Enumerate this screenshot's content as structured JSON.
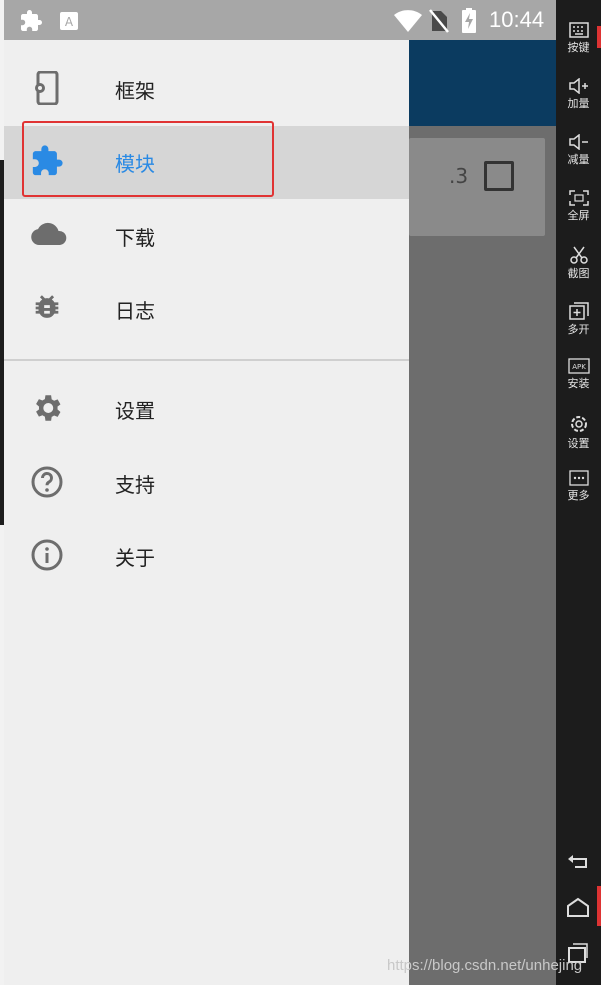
{
  "status_bar": {
    "time": "10:44",
    "icons": [
      "puzzle-icon",
      "a-box-icon",
      "wifi-icon",
      "no-sim-icon",
      "battery-charging-icon"
    ]
  },
  "app_background": {
    "card_version": ".3"
  },
  "drawer": {
    "items": [
      {
        "label": "框架",
        "icon": "phone-settings-icon"
      },
      {
        "label": "模块",
        "icon": "puzzle-icon",
        "selected": true
      },
      {
        "label": "下载",
        "icon": "cloud-icon"
      },
      {
        "label": "日志",
        "icon": "bug-icon"
      },
      {
        "label": "设置",
        "icon": "gear-icon"
      },
      {
        "label": "支持",
        "icon": "help-circle-icon"
      },
      {
        "label": "关于",
        "icon": "info-circle-icon"
      }
    ],
    "accent_color": "#2a8ae4"
  },
  "side_toolbar": {
    "buttons": [
      {
        "label": "按键",
        "icon": "keyboard-icon"
      },
      {
        "label": "加量",
        "icon": "volume-up-icon"
      },
      {
        "label": "减量",
        "icon": "volume-down-icon"
      },
      {
        "label": "全屏",
        "icon": "fullscreen-icon"
      },
      {
        "label": "截图",
        "icon": "scissors-icon"
      },
      {
        "label": "多开",
        "icon": "multi-open-icon"
      },
      {
        "label": "安装",
        "icon": "apk-icon"
      },
      {
        "label": "设置",
        "icon": "settings-icon"
      },
      {
        "label": "更多",
        "icon": "more-icon"
      }
    ],
    "system_nav": [
      "back-icon",
      "home-icon",
      "recents-icon"
    ]
  },
  "watermark": "https://blog.csdn.net/unhejing"
}
